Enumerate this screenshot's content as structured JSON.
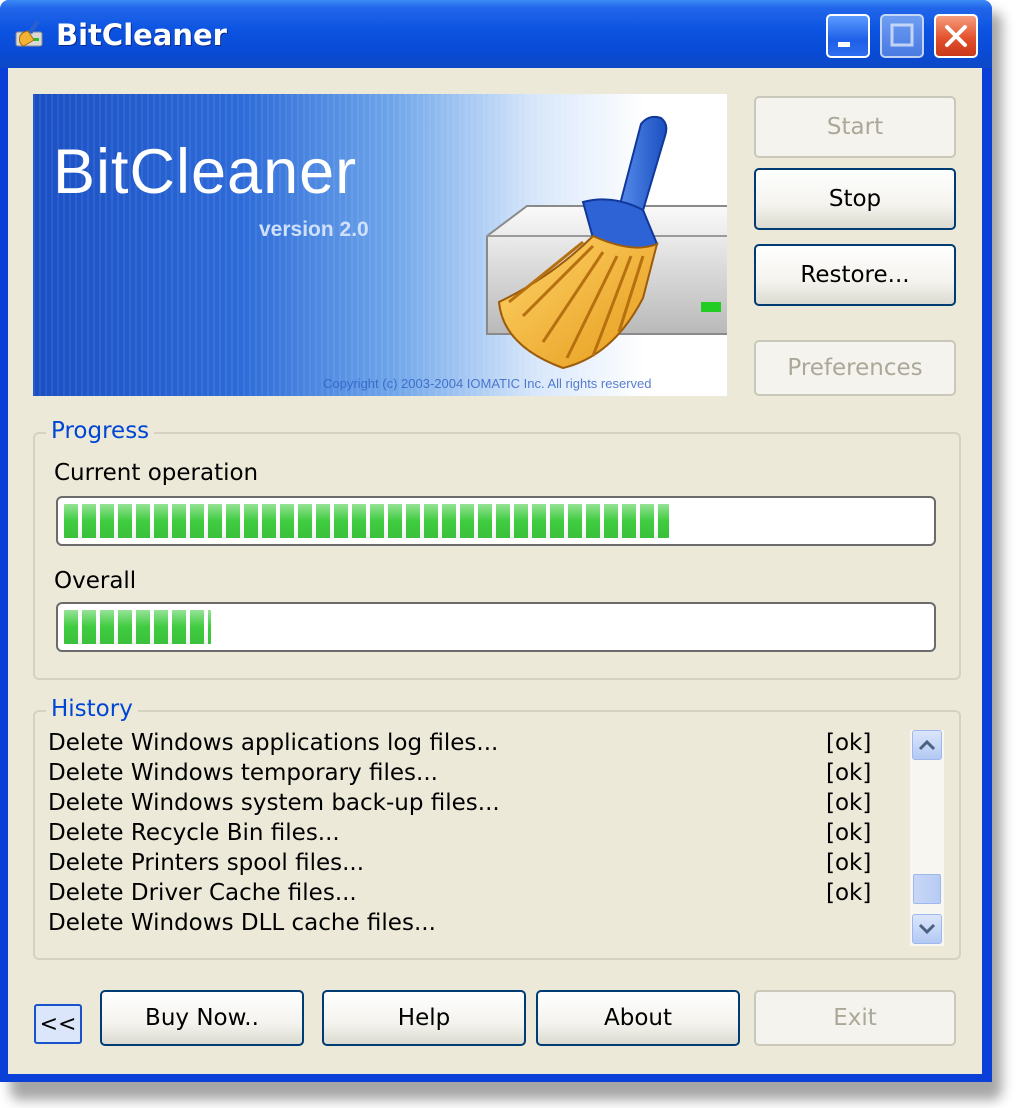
{
  "window": {
    "title": "BitCleaner"
  },
  "banner": {
    "title": "BitCleaner",
    "version": "version 2.0",
    "copyright": "Copyright (c) 2003-2004 IOMATIC Inc. All rights reserved"
  },
  "actions": {
    "start": "Start",
    "stop": "Stop",
    "restore": "Restore...",
    "preferences": "Preferences"
  },
  "progress": {
    "group_label": "Progress",
    "current_label": "Current operation",
    "current_fraction": 0.7,
    "overall_label": "Overall",
    "overall_fraction": 0.17
  },
  "history": {
    "group_label": "History",
    "items": [
      {
        "text": "Delete Windows applications log files...",
        "status": "[ok]"
      },
      {
        "text": "Delete Windows temporary files...",
        "status": "[ok]"
      },
      {
        "text": "Delete Windows system back-up files...",
        "status": "[ok]"
      },
      {
        "text": "Delete Recycle Bin files...",
        "status": "[ok]"
      },
      {
        "text": "Delete Printers spool files...",
        "status": "[ok]"
      },
      {
        "text": "Delete Driver Cache files...",
        "status": "[ok]"
      },
      {
        "text": "Delete Windows DLL cache files...",
        "status": ""
      }
    ]
  },
  "footer": {
    "collapse": "<<",
    "buy_now": "Buy Now..",
    "help": "Help",
    "about": "About",
    "exit": "Exit"
  },
  "colors": {
    "titlebar": "#0a4bd6",
    "face": "#ece9d8",
    "progress_fill": "#3fcc3f",
    "group_label": "#0046d5"
  }
}
